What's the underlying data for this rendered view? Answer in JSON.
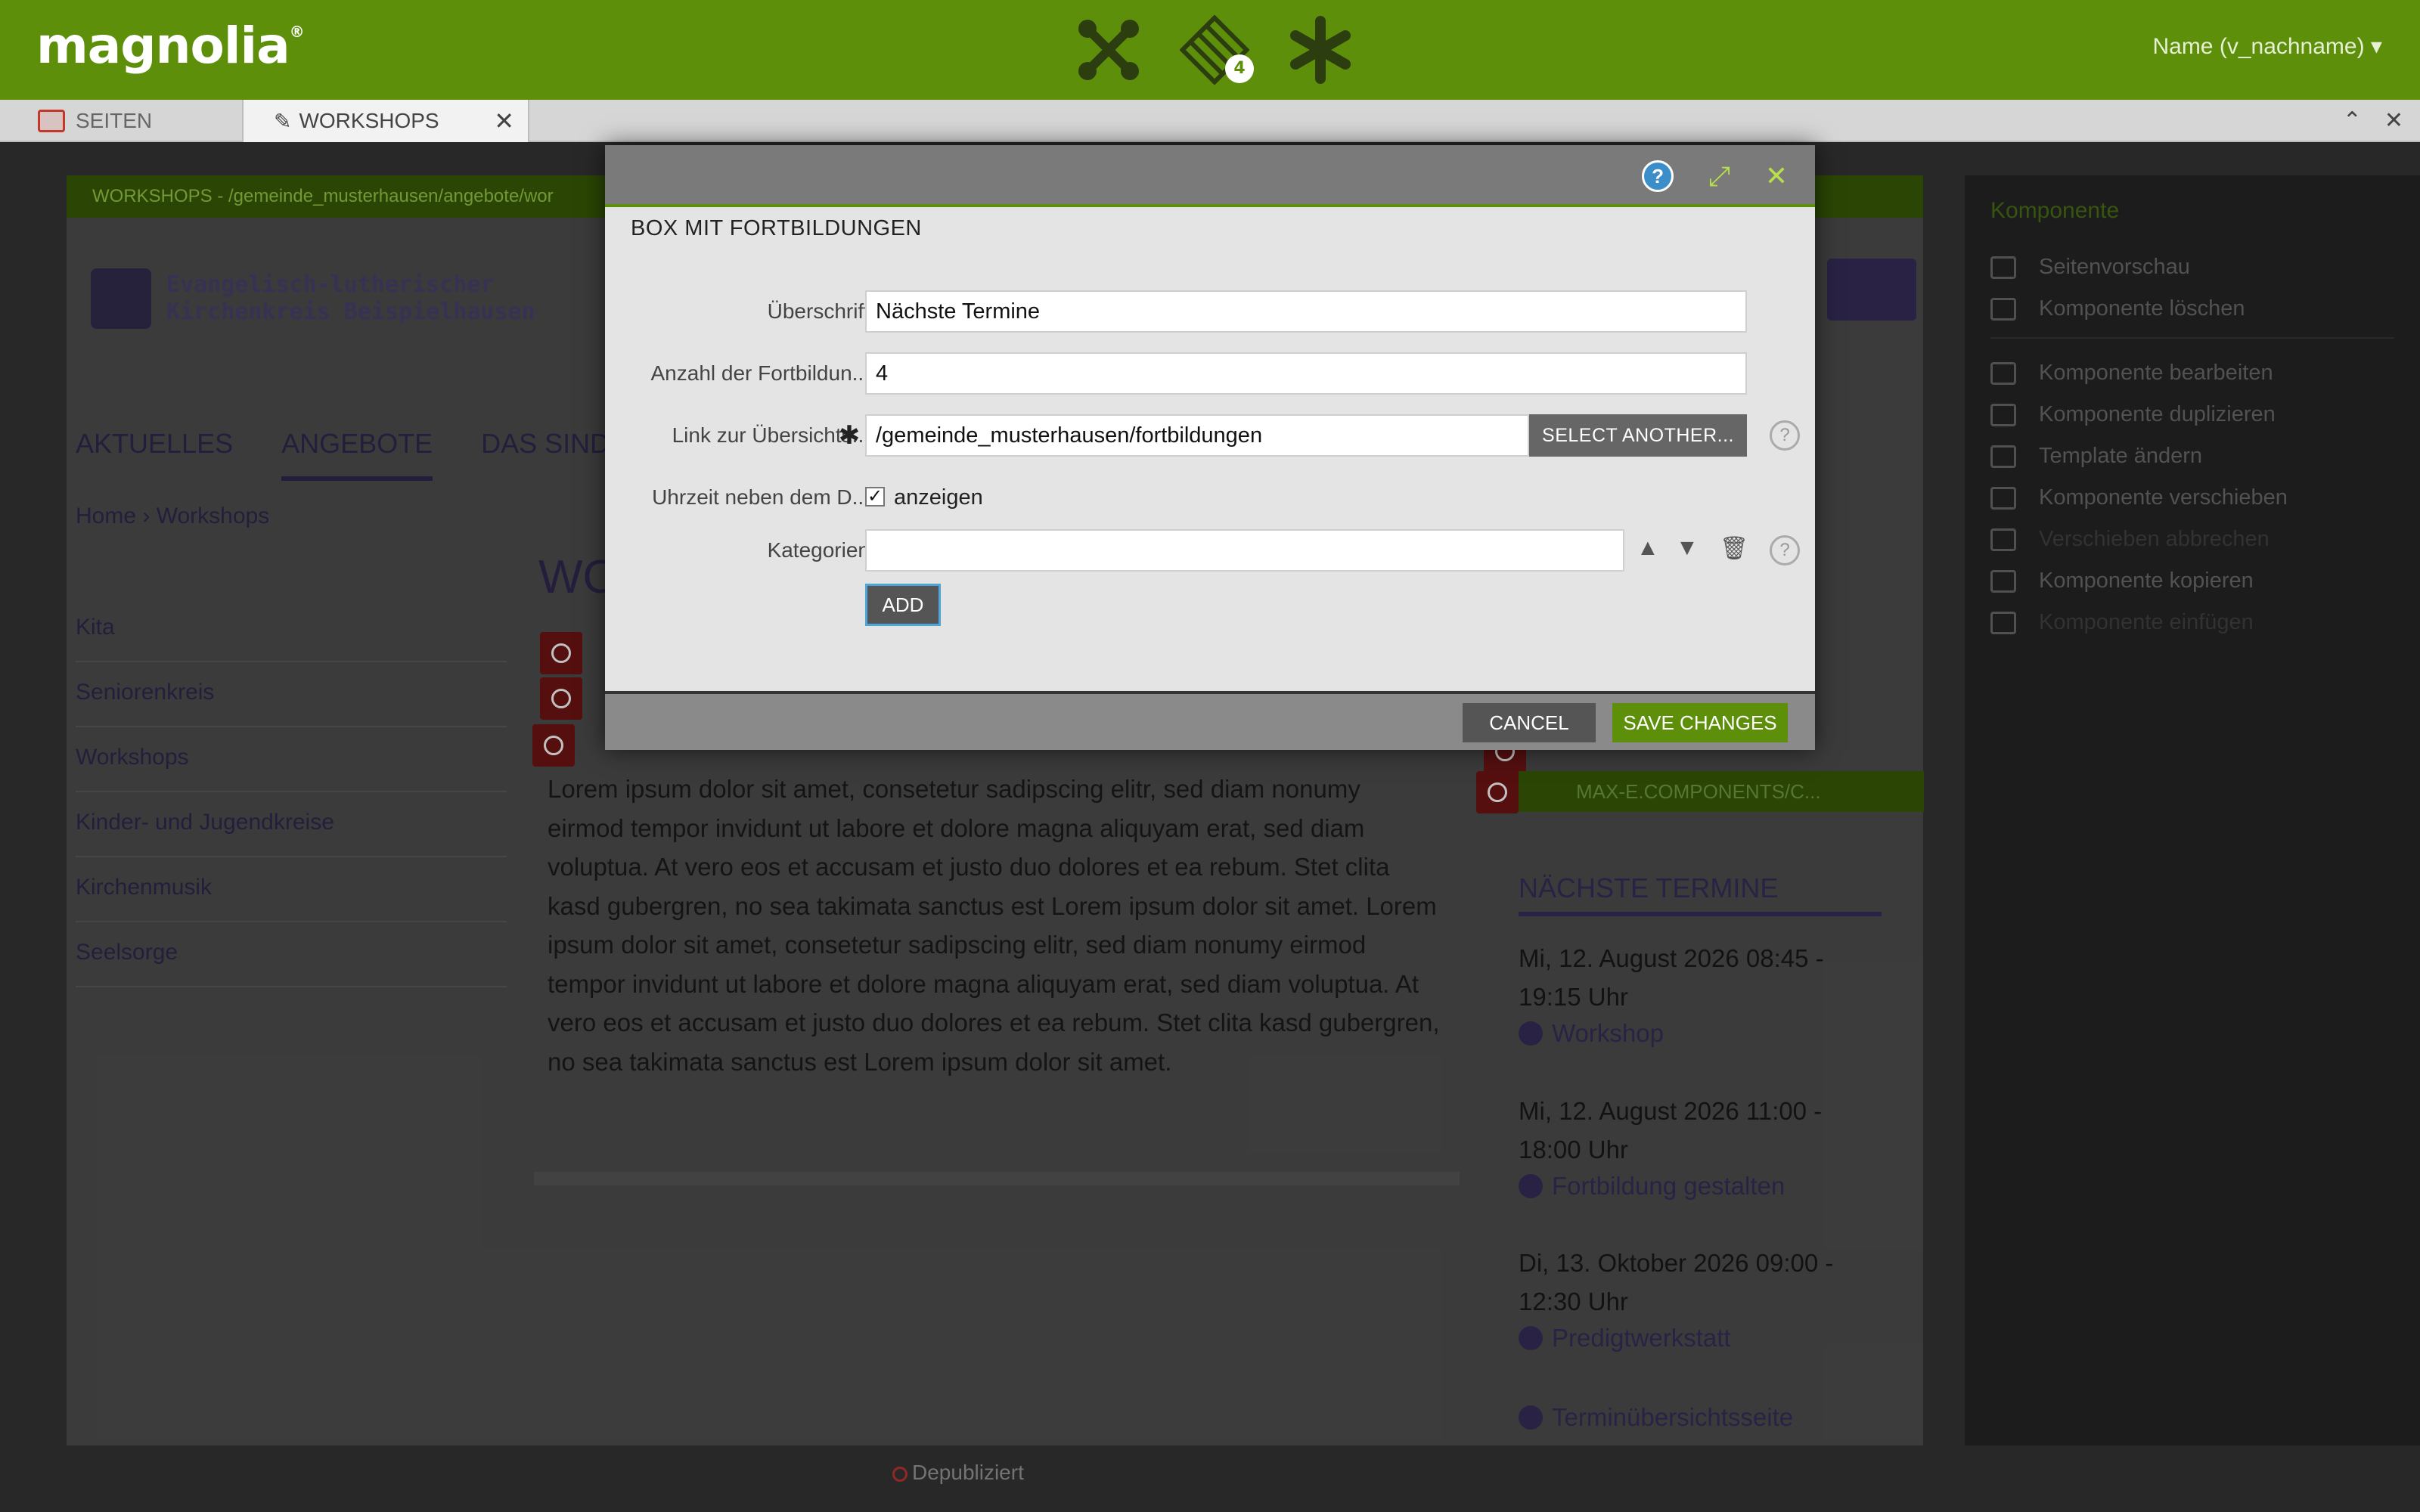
{
  "app": {
    "logo": "magnolia",
    "logo_mark": "®",
    "badge_count": "4",
    "user": "Name (v_nachname)",
    "accent": "#5d8f0a"
  },
  "tabs": [
    {
      "label": "SEITEN"
    },
    {
      "label": "WORKSHOPS"
    }
  ],
  "page": {
    "header_path": "WORKSHOPS - /gemeinde_musterhausen/angebote/wor",
    "site_name_1": "Evangelisch-lutherischer",
    "site_name_2": "Kirchenkreis Beispielhausen",
    "nav": [
      "AKTUELLES",
      "ANGEBOTE",
      "DAS SIND W"
    ],
    "breadcrumb_home": "Home",
    "breadcrumb_current": "Workshops",
    "sidenav": [
      "Kita",
      "Seniorenkreis",
      "Workshops",
      "Kinder- und Jugendkreise",
      "Kirchenmusik",
      "Seelsorge"
    ],
    "content_title": "WO",
    "content_text": "Lorem ipsum dolor sit amet, consetetur sadipscing elitr, sed diam nonumy eirmod tempor invidunt ut labore et dolore magna aliquyam erat, sed diam voluptua. At vero eos et accusam et justo duo dolores et ea rebum. Stet clita kasd gubergren, no sea takimata sanctus est Lorem ipsum dolor sit amet. Lorem ipsum dolor sit amet, consetetur sadipscing elitr, sed diam nonumy eirmod tempor invidunt ut labore et dolore magna aliquyam erat, sed diam voluptua. At vero eos et accusam et justo duo dolores et ea rebum. Stet clita kasd gubergren, no sea takimata sanctus est Lorem ipsum dolor sit amet.",
    "right_component": "MAX-E.COMPONENTS/C...",
    "sidebox_title": "NÄCHSTE TERMINE",
    "events": [
      {
        "date": "Mi, 12. August 2026 08:45 - 19:15 Uhr",
        "link": "Workshop"
      },
      {
        "date": "Mi, 12. August 2026 11:00 - 18:00 Uhr",
        "link": "Fortbildung gestalten"
      },
      {
        "date": "Di, 13. Oktober 2026 09:00 - 12:30 Uhr",
        "link": "Predigtwerkstatt"
      }
    ],
    "overview_link": "Terminübersichtsseite",
    "status": "Depubliziert"
  },
  "panel": {
    "title": "Komponente",
    "items": [
      {
        "label": "Seitenvorschau",
        "enabled": true
      },
      {
        "label": "Komponente löschen",
        "enabled": true
      },
      {
        "label": "Komponente bearbeiten",
        "enabled": true
      },
      {
        "label": "Komponente duplizieren",
        "enabled": true
      },
      {
        "label": "Template ändern",
        "enabled": true
      },
      {
        "label": "Komponente verschieben",
        "enabled": true
      },
      {
        "label": "Verschieben abbrechen",
        "enabled": false
      },
      {
        "label": "Komponente kopieren",
        "enabled": true
      },
      {
        "label": "Komponente einfügen",
        "enabled": false
      }
    ]
  },
  "dialog": {
    "title": "BOX MIT FORTBILDUNGEN",
    "fields": {
      "heading_label": "Überschrift",
      "heading_value": "Nächste Termine",
      "count_label": "Anzahl der Fortbildun...",
      "count_value": "4",
      "link_label": "Link zur Übersichts...",
      "link_value": "/gemeinde_musterhausen/fortbildungen",
      "select_label": "SELECT ANOTHER...",
      "time_label": "Uhrzeit neben dem D...",
      "time_check_label": "anzeigen",
      "categories_label": "Kategorien",
      "categories_value": "",
      "add_label": "ADD"
    },
    "cancel_label": "CANCEL",
    "save_label": "SAVE CHANGES"
  }
}
